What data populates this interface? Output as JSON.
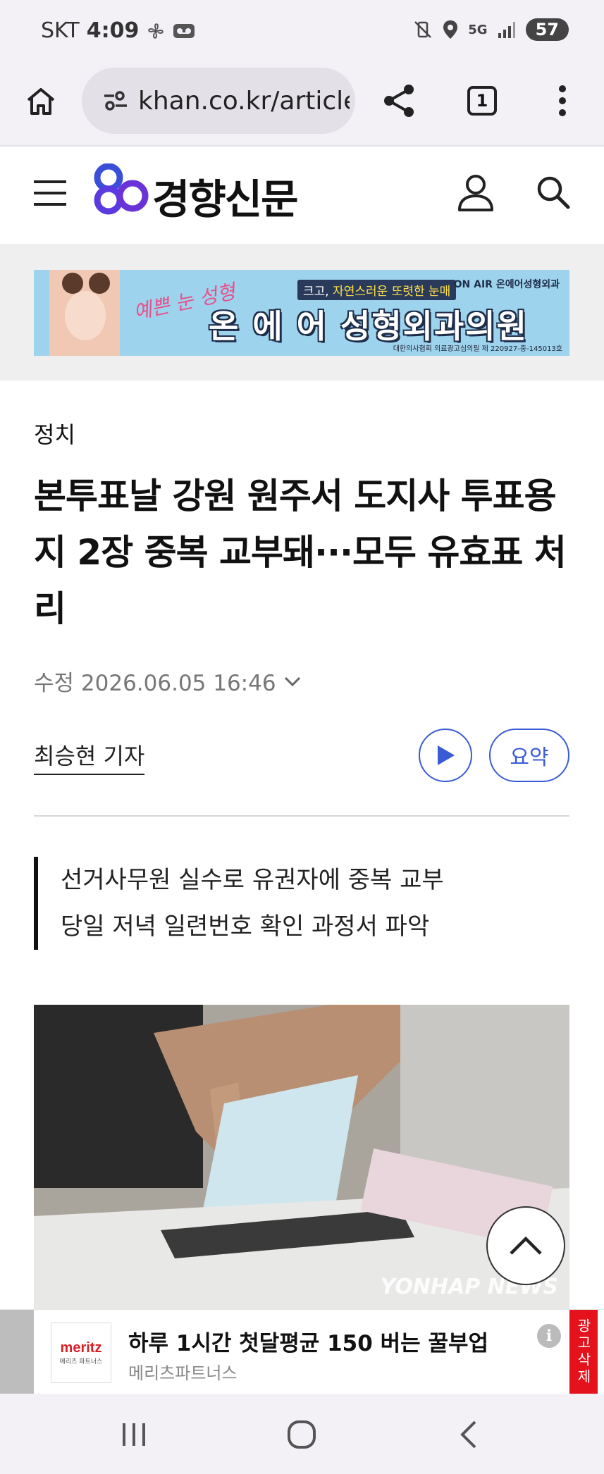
{
  "status_bar": {
    "carrier": "SKT",
    "time": "4:09",
    "battery": "57",
    "network": "5G"
  },
  "browser": {
    "url": "khan.co.kr/article",
    "tab_count": "1"
  },
  "site": {
    "logo_text": "경향신문"
  },
  "top_ad": {
    "tagline_part1": "크고, ",
    "tagline_part2": "자연스러운 또렷한 눈매",
    "main_text": "온 에 어 성형외과의원",
    "script_text": "예쁜 눈 성형",
    "brand_tag": "ON AIR 온에어성형외과",
    "fine_print": "대한의사협회 의료광고심의필 제 220927-중-145013호"
  },
  "article": {
    "category": "정치",
    "headline": "본투표날 강원 원주서 도지사 투표용지 2장 중복 교부돼···모두 유효표 처리",
    "date": "수정 2026.06.05 16:46",
    "reporter": "최승현 기자",
    "summary_button": "요약",
    "subheads": [
      "선거사무원 실수로 유권자에 중복 교부",
      "당일 저녁 일련번호 확인 과정서 파악"
    ],
    "photo_credit": "YONHAP NEWS"
  },
  "bottom_ad": {
    "title": "하루 1시간 첫달평균 150 버는 꿀부업",
    "brand": "메리츠파트너스",
    "logo_text": "meritz",
    "logo_sub": "메리츠 파트너스",
    "close_label": "광고삭제",
    "info_label": "i"
  },
  "colors": {
    "accent": "#3b5bd6",
    "close_red": "#e3121c",
    "ad_sky": "#9ed3ee"
  }
}
